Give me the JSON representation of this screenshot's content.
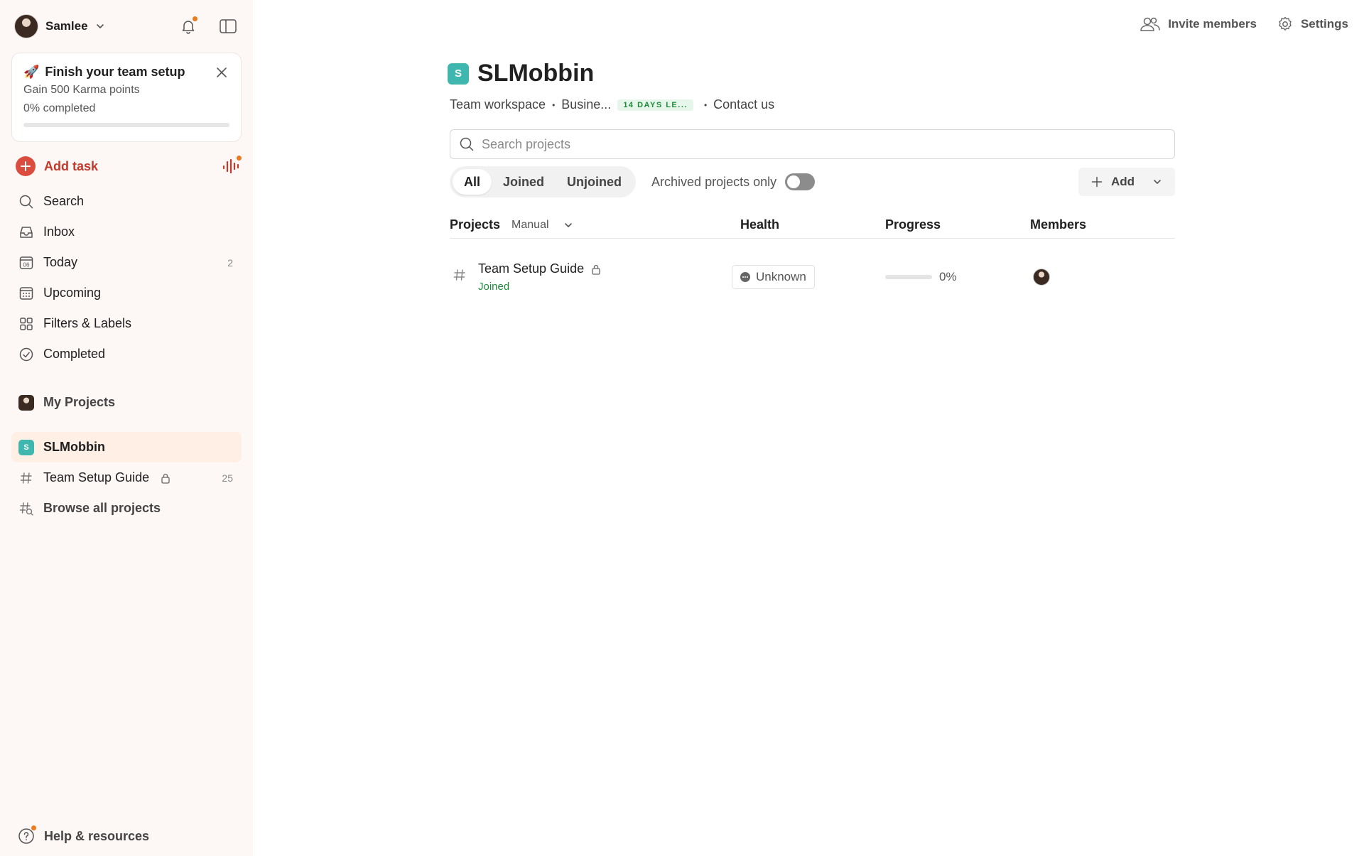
{
  "user": {
    "name": "Samlee"
  },
  "setup_card": {
    "title": "Finish your team setup",
    "subtitle": "Gain 500 Karma points",
    "progress_text": "0% completed",
    "progress_fraction": 0
  },
  "add_task": {
    "label": "Add task"
  },
  "nav": [
    {
      "id": "search",
      "label": "Search",
      "count": ""
    },
    {
      "id": "inbox",
      "label": "Inbox",
      "count": ""
    },
    {
      "id": "today",
      "label": "Today",
      "count": "2",
      "icon_text": "06"
    },
    {
      "id": "upcoming",
      "label": "Upcoming",
      "count": ""
    },
    {
      "id": "filters",
      "label": "Filters & Labels",
      "count": ""
    },
    {
      "id": "completed",
      "label": "Completed",
      "count": ""
    }
  ],
  "my_projects": {
    "label": "My Projects"
  },
  "workspace": {
    "badge": "S",
    "name": "SLMobbin",
    "project_name": "Team Setup Guide",
    "project_count": "25",
    "browse_label": "Browse all projects"
  },
  "help": {
    "label": "Help & resources"
  },
  "topbar": {
    "invite_label": "Invite members",
    "settings_label": "Settings"
  },
  "main": {
    "badge": "S",
    "title": "SLMobbin",
    "meta": {
      "workspace_type": "Team workspace",
      "plan": "Busine...",
      "trial_badge": "14 DAYS LE...",
      "contact": "Contact us"
    },
    "search_placeholder": "Search projects",
    "tabs": [
      {
        "label": "All",
        "active": true
      },
      {
        "label": "Joined",
        "active": false
      },
      {
        "label": "Unjoined",
        "active": false
      }
    ],
    "archived_label": "Archived projects only",
    "archived_on": false,
    "add_label": "Add",
    "table": {
      "headers": {
        "projects": "Projects",
        "sort": "Manual",
        "health": "Health",
        "progress": "Progress",
        "members": "Members"
      },
      "rows": [
        {
          "name": "Team Setup Guide",
          "status": "Joined",
          "health": "Unknown",
          "progress_text": "0%",
          "progress_fraction": 0
        }
      ]
    }
  },
  "colors": {
    "accent_red": "#dc4c3e",
    "workspace_teal": "#3fb7ae",
    "sidebar_bg": "#fdf8f6",
    "active_bg": "#ffefe5",
    "notification_orange": "#eb7b1f",
    "joined_green": "#1f8a3a"
  }
}
